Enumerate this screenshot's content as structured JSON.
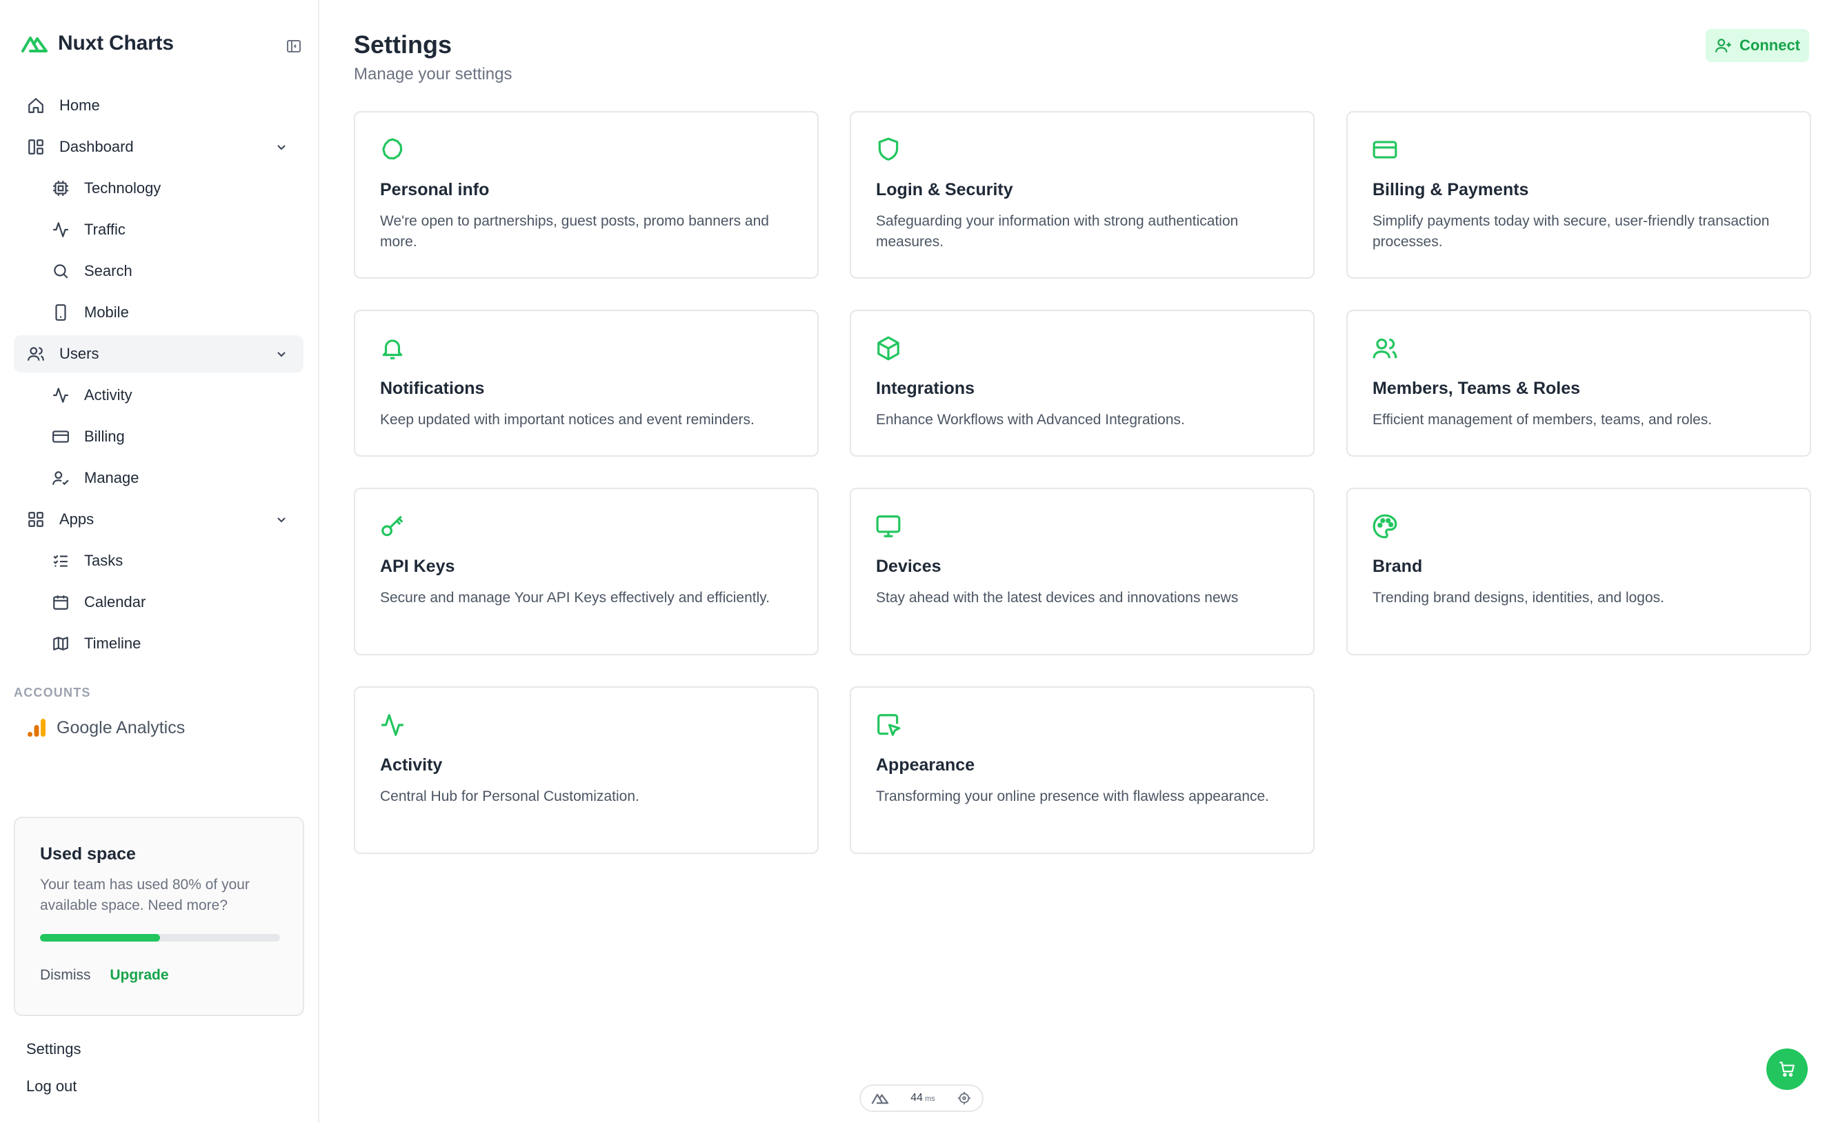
{
  "brand": {
    "name": "Nuxt Charts"
  },
  "nav": {
    "home": "Home",
    "dashboard": "Dashboard",
    "technology": "Technology",
    "traffic": "Traffic",
    "search": "Search",
    "mobile": "Mobile",
    "users": "Users",
    "activity": "Activity",
    "billing": "Billing",
    "manage": "Manage",
    "apps": "Apps",
    "tasks": "Tasks",
    "calendar": "Calendar",
    "timeline": "Timeline"
  },
  "accounts": {
    "label": "ACCOUNTS",
    "items": [
      {
        "label": "Google Analytics",
        "icon": "google-analytics-icon"
      }
    ]
  },
  "used_space": {
    "title": "Used space",
    "text": "Your team has used 80% of your available space. Need more?",
    "progress_percent": 50,
    "dismiss": "Dismiss",
    "upgrade": "Upgrade"
  },
  "footer_links": {
    "settings": "Settings",
    "logout": "Log out"
  },
  "header": {
    "title": "Settings",
    "subtitle": "Manage your settings",
    "connect": "Connect"
  },
  "cards": [
    {
      "title": "Personal info",
      "desc": "We're open to partnerships, guest posts, promo banners and more.",
      "icon": "badge-icon"
    },
    {
      "title": "Login & Security",
      "desc": "Safeguarding your information with strong authentication measures.",
      "icon": "shield-icon"
    },
    {
      "title": "Billing & Payments",
      "desc": "Simplify payments today with secure, user-friendly transaction processes.",
      "icon": "credit-card-icon"
    },
    {
      "title": "Notifications",
      "desc": "Keep updated with important notices and event reminders.",
      "icon": "bell-icon"
    },
    {
      "title": "Integrations",
      "desc": "Enhance Workflows with Advanced Integrations.",
      "icon": "box-icon"
    },
    {
      "title": "Members, Teams & Roles",
      "desc": "Efficient management of members, teams, and roles.",
      "icon": "users-icon"
    },
    {
      "title": "API Keys",
      "desc": "Secure and manage Your API Keys effectively and efficiently.",
      "icon": "key-icon"
    },
    {
      "title": "Devices",
      "desc": "Stay ahead with the latest devices and innovations news",
      "icon": "monitor-icon"
    },
    {
      "title": "Brand",
      "desc": "Trending brand designs, identities, and logos.",
      "icon": "palette-icon"
    },
    {
      "title": "Activity",
      "desc": "Central Hub for Personal Customization.",
      "icon": "activity-icon"
    },
    {
      "title": "Appearance",
      "desc": "Transforming your online presence with flawless appearance.",
      "icon": "cursor-square-icon"
    }
  ],
  "perf": {
    "value": "44",
    "unit": "ms"
  },
  "colors": {
    "accent": "#22c55e",
    "accent_dark": "#16a34a",
    "accent_soft": "#dcfce7"
  }
}
